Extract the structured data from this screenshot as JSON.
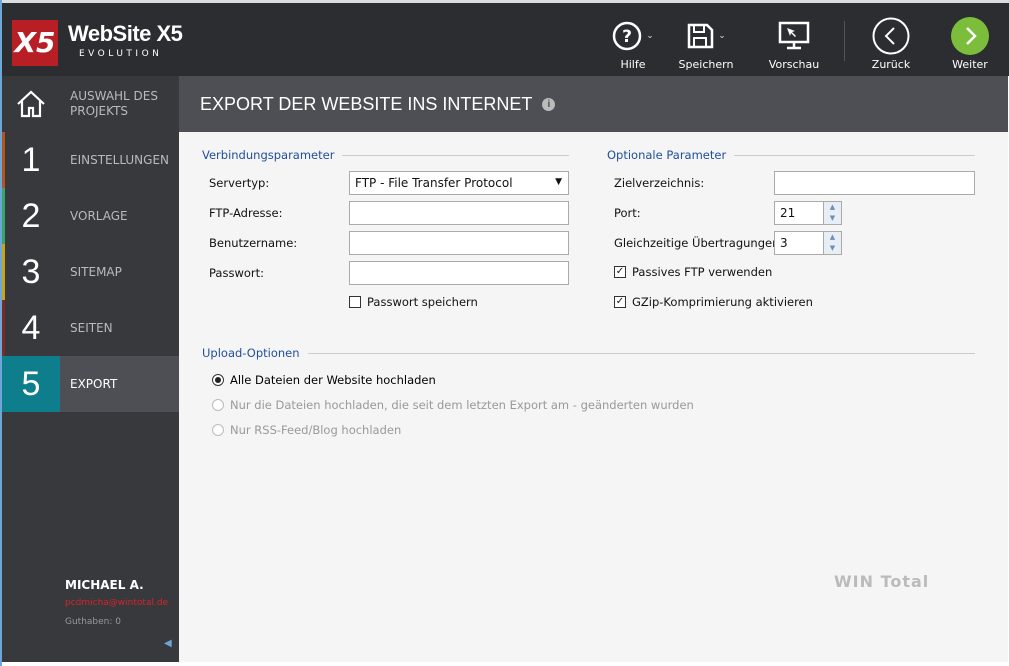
{
  "app": {
    "logo": "X5",
    "brand": "WebSite X5",
    "edition": "EVOLUTION"
  },
  "toolbar": {
    "help": "Hilfe",
    "save": "Speichern",
    "preview": "Vorschau",
    "back": "Zurück",
    "next": "Weiter"
  },
  "sidebar": {
    "items": [
      {
        "num": "",
        "label": "AUSWAHL DES PROJEKTS",
        "color": "#38393d"
      },
      {
        "num": "1",
        "label": "EINSTELLUNGEN",
        "color": "#b5541d"
      },
      {
        "num": "2",
        "label": "VORLAGE",
        "color": "#3aa56b"
      },
      {
        "num": "3",
        "label": "SITEMAP",
        "color": "#c8a41b"
      },
      {
        "num": "4",
        "label": "SEITEN",
        "color": "#7a2a2a"
      },
      {
        "num": "5",
        "label": "EXPORT",
        "color": "#0e7d8c"
      }
    ],
    "user": "MICHAEL A.",
    "email": "pcdmicha@wintotal.de",
    "credit": "Guthaben: 0"
  },
  "page": {
    "title": "EXPORT DER WEBSITE INS INTERNET"
  },
  "connection": {
    "title": "Verbindungsparameter",
    "server_type_label": "Servertyp:",
    "server_type": "FTP - File Transfer Protocol",
    "ftp_label": "FTP-Adresse:",
    "ftp": "",
    "user_label": "Benutzername:",
    "user": "",
    "pass_label": "Passwort:",
    "pass": "",
    "save_pass": "Passwort speichern"
  },
  "optional": {
    "title": "Optionale Parameter",
    "dir_label": "Zielverzeichnis:",
    "dir": "",
    "port_label": "Port:",
    "port": "21",
    "parallel_label": "Gleichzeitige Übertragungen:",
    "parallel": "3",
    "passive": "Passives FTP verwenden",
    "gzip": "GZip-Komprimierung aktivieren"
  },
  "upload": {
    "title": "Upload-Optionen",
    "options": [
      "Alle Dateien der Website hochladen",
      "Nur die Dateien hochladen, die seit dem letzten Export am - geänderten wurden",
      "Nur RSS-Feed/Blog hochladen"
    ]
  },
  "watermark": "WIN Total"
}
